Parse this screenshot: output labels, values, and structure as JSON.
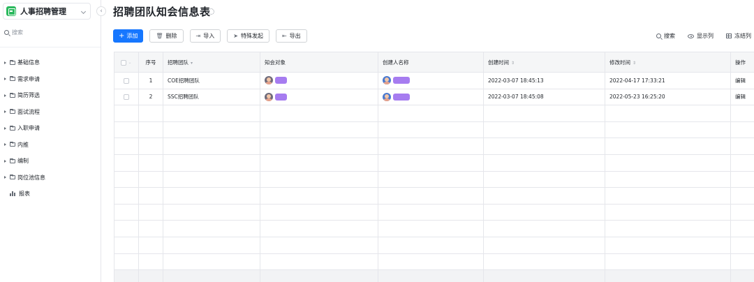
{
  "app": {
    "name": "人事招聘管理"
  },
  "sidebar": {
    "search_placeholder": "搜索",
    "items": [
      {
        "label": "基础信息"
      },
      {
        "label": "需求申请"
      },
      {
        "label": "简历筛选"
      },
      {
        "label": "面试流程"
      },
      {
        "label": "入职申请"
      },
      {
        "label": "内推"
      },
      {
        "label": "编制"
      },
      {
        "label": "岗位池信息"
      }
    ],
    "report_label": "报表"
  },
  "page": {
    "title": "招聘团队知会信息表"
  },
  "toolbar": {
    "add": "添加",
    "delete": "删除",
    "import": "导入",
    "special": "特殊发起",
    "export": "导出",
    "search": "搜索",
    "show_columns": "显示列",
    "freeze_columns": "冻结列"
  },
  "table": {
    "columns": {
      "index": "序号",
      "team": "招聘团队",
      "notify": "知会对象",
      "creator": "创建人名称",
      "created": "创建时间",
      "modified": "修改时间",
      "action": "操作"
    },
    "rows": [
      {
        "index": "1",
        "team": "COE招聘团队",
        "created": "2022-03-07 18:45:13",
        "modified": "2022-04-17 17:33:21",
        "action": "编辑"
      },
      {
        "index": "2",
        "team": "SSC招聘团队",
        "created": "2022-03-07 18:45:08",
        "modified": "2022-05-23 16:25:20",
        "action": "编辑"
      }
    ]
  },
  "colors": {
    "primary": "#1677ff",
    "redaction": "#a67cf0",
    "logo": "#2bb95e"
  }
}
